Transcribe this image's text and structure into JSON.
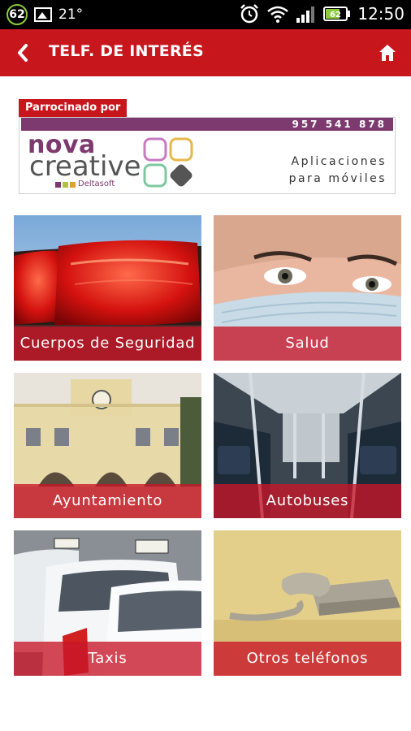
{
  "status_bar": {
    "notification_count": "62",
    "temperature": "21°",
    "battery": "62",
    "time": "12:50"
  },
  "header": {
    "title": "TELF. DE INTERÉS"
  },
  "sponsor": {
    "tag": "Parrocinado por",
    "phone": "957 541 878",
    "brand_top": "nova",
    "brand_bottom": "creative",
    "brand_sub": "Deltasoft",
    "tagline_1": "Aplicaciones",
    "tagline_2": "para móviles"
  },
  "tiles": [
    {
      "label": "Cuerpos de Seguridad"
    },
    {
      "label": "Salud"
    },
    {
      "label": "Ayuntamiento"
    },
    {
      "label": "Autobuses"
    },
    {
      "label": "Taxis"
    },
    {
      "label": "Otros teléfonos"
    }
  ],
  "colors": {
    "accent": "#c8161d",
    "brand_purple": "#7c3a6e"
  }
}
